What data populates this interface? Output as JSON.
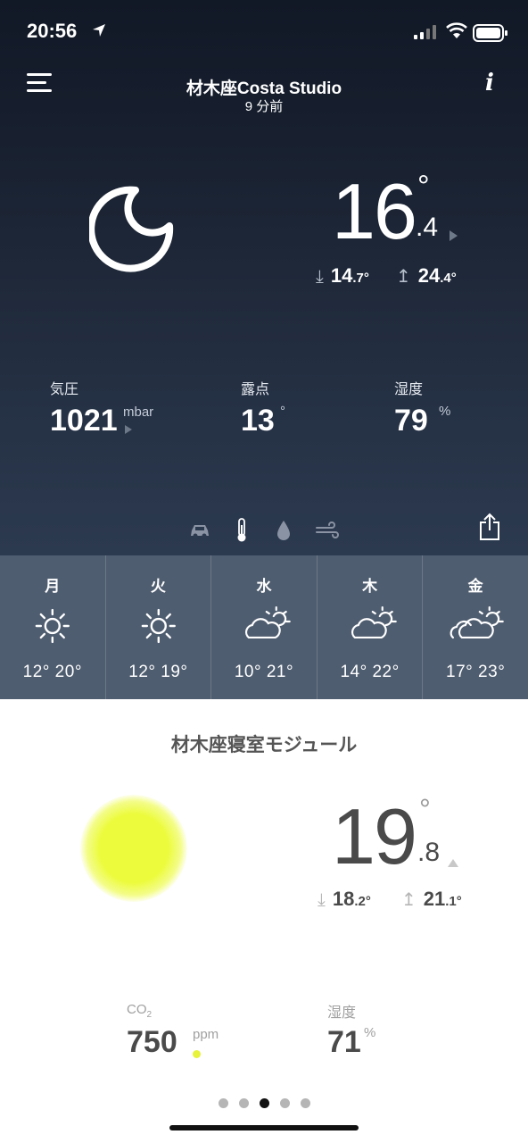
{
  "status_bar": {
    "time": "20:56"
  },
  "header": {
    "station_name": "材木座Costa Studio",
    "updated": "9 分前"
  },
  "outdoor": {
    "weather_icon": "moon-icon",
    "temp_int": "16",
    "temp_dec": ".4",
    "degree": "°",
    "min_int": "14",
    "min_dec": ".7",
    "max_int": "24",
    "max_dec": ".4",
    "deg_small": "°",
    "down_arrow": "⤓",
    "up_arrow": "↥"
  },
  "measures": [
    {
      "label": "気圧",
      "value": "1021",
      "unit": "mbar"
    },
    {
      "label": "露点",
      "value": "13",
      "unit": "°"
    },
    {
      "label": "湿度",
      "value": "79",
      "unit": "%"
    }
  ],
  "toolbar": {
    "icons": [
      "car-icon",
      "thermometer-icon",
      "drop-icon",
      "wind-icon"
    ],
    "share_icon": "share-icon"
  },
  "forecast": [
    {
      "day": "月",
      "icon": "sun",
      "temps": "12° 20°"
    },
    {
      "day": "火",
      "icon": "sun",
      "temps": "12° 19°"
    },
    {
      "day": "水",
      "icon": "sun-cloud",
      "temps": "10° 21°"
    },
    {
      "day": "木",
      "icon": "sun-cloud",
      "temps": "14° 22°"
    },
    {
      "day": "金",
      "icon": "sun-clouds",
      "temps": "17° 23°"
    }
  ],
  "module": {
    "name": "材木座寝室モジュール",
    "temp_int": "19",
    "temp_dec": ".8",
    "degree": "°",
    "min_int": "18",
    "min_dec": ".2",
    "max_int": "21",
    "max_dec": ".1",
    "deg_small": "°",
    "co2_label": "CO",
    "co2_sub": "2",
    "co2_value": "750",
    "co2_unit": "ppm",
    "humidity_label": "湿度",
    "humidity_value": "71",
    "humidity_unit": "%",
    "air_quality_color": "#ecfb3b"
  },
  "pagination": {
    "count": 5,
    "active": 2
  },
  "colors": {
    "header_dark": "#111826",
    "forecast_bg": "#4f5d70"
  }
}
